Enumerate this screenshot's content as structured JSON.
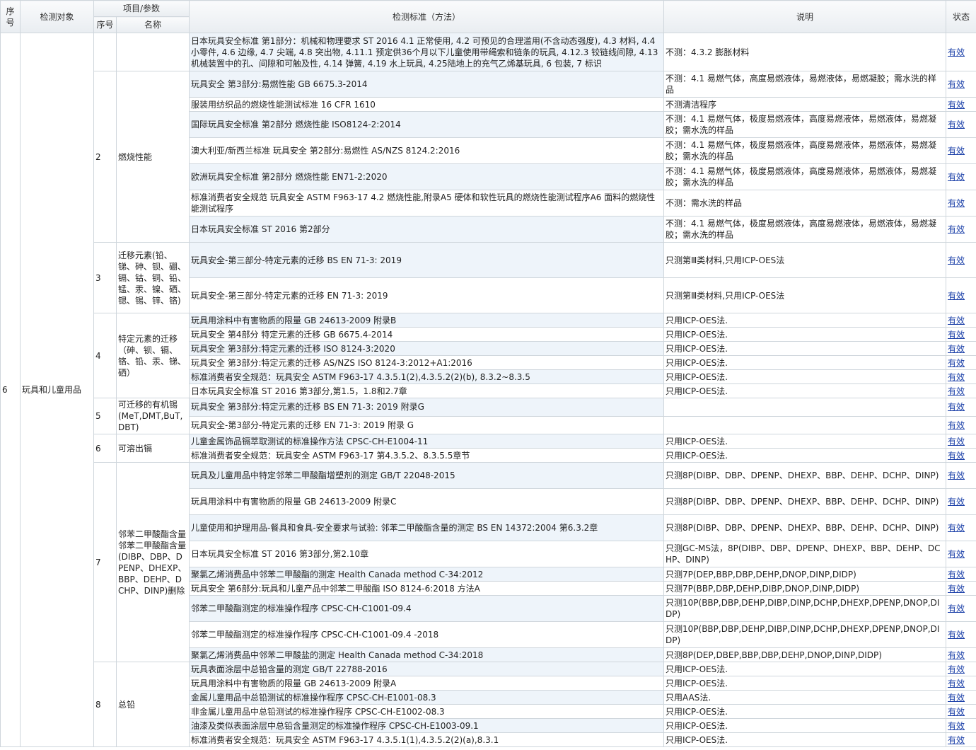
{
  "headers": {
    "seq": "序号",
    "object": "检测对象",
    "item_param": "项目/参数",
    "sub_seq": "序号",
    "sub_name": "名称",
    "standard": "检测标准（方法）",
    "note": "说明",
    "status": "状态"
  },
  "object_row": {
    "seq": "6",
    "object": "玩具和儿童用品"
  },
  "groups": [
    {
      "no": "",
      "name": "",
      "rows": [
        {
          "std": "日本玩具安全标准 第1部分：机械和物理要求 ST 2016 4.1 正常使用, 4.2 可预见的合理滥用(不含动态强度), 4.3 材料, 4.4 小零件, 4.6 边缘, 4.7 尖端, 4.8 突出物, 4.11.1 预定供36个月以下儿童使用带绳索和链条的玩具, 4.12.3 铰链线间隙, 4.13 机械装置中的孔、间隙和可触及性, 4.14 弹簧, 4.19 水上玩具, 4.25陆地上的充气乙烯基玩具, 6 包装, 7 标识",
          "note": "不测：4.3.2 膨胀材料",
          "status": "有效"
        }
      ]
    },
    {
      "no": "2",
      "name": "燃烧性能",
      "rows": [
        {
          "std": "玩具安全 第3部分:易燃性能 GB 6675.3-2014",
          "note": "不测：4.1 易燃气体，高度易燃液体，易燃液体，易燃凝胶；需水洗的样品",
          "status": "有效"
        },
        {
          "std": "服装用纺织品的燃烧性能测试标准 16 CFR 1610",
          "note": "不测清洁程序",
          "status": "有效"
        },
        {
          "std": "国际玩具安全标准 第2部分 燃烧性能 ISO8124-2:2014",
          "note": "不测：4.1 易燃气体，极度易燃液体，高度易燃液体，易燃液体，易燃凝胶；需水洗的样品",
          "status": "有效"
        },
        {
          "std": "澳大利亚/新西兰标准 玩具安全 第2部分:易燃性 AS/NZS 8124.2:2016",
          "note": "不测：4.1 易燃气体，极度易燃液体，高度易燃液体，易燃液体，易燃凝胶；需水洗的样品",
          "status": "有效"
        },
        {
          "std": "欧洲玩具安全标准 第2部分 燃烧性能 EN71-2:2020",
          "note": "不测：4.1 易燃气体，极度易燃液体，高度易燃液体，易燃液体，易燃凝胶；需水洗的样品",
          "status": "有效"
        },
        {
          "std": "标准消费者安全规范 玩具安全 ASTM F963-17 4.2 燃烧性能,附录A5 硬体和软性玩具的燃烧性能测试程序A6 面料的燃烧性能测试程序",
          "note": "不测：需水洗的样品",
          "status": "有效"
        },
        {
          "std": "日本玩具安全标准 ST 2016 第2部分",
          "note": "不测：4.1 易燃气体，极度易燃液体，高度易燃液体，易燃液体，易燃凝胶；需水洗的样品",
          "status": "有效"
        }
      ]
    },
    {
      "no": "3",
      "name": "迁移元素(铅、锑、砷、钡、硼、镉、钴、铜、铅、锰、汞、镍、硒、锶、锡、锌、铬)",
      "rows": [
        {
          "std": "玩具安全-第三部分-特定元素的迁移 BS EN 71-3: 2019",
          "note": "只测第Ⅲ类材料,只用ICP-OES法",
          "status": "有效"
        },
        {
          "std": "玩具安全-第三部分-特定元素的迁移 EN 71-3: 2019",
          "note": "只测第Ⅲ类材料,只用ICP-OES法",
          "status": "有效"
        }
      ]
    },
    {
      "no": "4",
      "name": "特定元素的迁移（砷、钡、镉、铬、铅、汞、锑、硒）",
      "rows": [
        {
          "std": "玩具用涂料中有害物质的限量 GB 24613-2009 附录B",
          "note": "只用ICP-OES法.",
          "status": "有效"
        },
        {
          "std": "玩具安全 第4部分 特定元素的迁移 GB 6675.4-2014",
          "note": "只用ICP-OES法.",
          "status": "有效"
        },
        {
          "std": "玩具安全 第3部分:特定元素的迁移 ISO 8124-3:2020",
          "note": "只用ICP-OES法.",
          "status": "有效"
        },
        {
          "std": "玩具安全 第3部分:特定元素的迁移 AS/NZS ISO 8124-3:2012+A1:2016",
          "note": "只用ICP-OES法.",
          "status": "有效"
        },
        {
          "std": "标准消费者安全规范：玩具安全 ASTM F963-17 4.3.5.1(2),4.3.5.2(2)(b), 8.3.2~8.3.5",
          "note": "只用ICP-OES法.",
          "status": "有效"
        },
        {
          "std": "日本玩具安全标准 ST 2016 第3部分,第1.5，1.8和2.7章",
          "note": "只用ICP-OES法.",
          "status": "有效"
        }
      ]
    },
    {
      "no": "5",
      "name": "可迁移的有机锡(MeT,DMT,BuT,DBT)",
      "rows": [
        {
          "std": "玩具安全 第3部分:特定元素的迁移 BS EN 71-3: 2019 附录G",
          "note": "",
          "status": "有效"
        },
        {
          "std": "玩具安全-第3部分-特定元素的迁移 EN 71-3: 2019 附录 G",
          "note": "",
          "status": "有效"
        }
      ]
    },
    {
      "no": "6",
      "name": "可溶出镉",
      "rows": [
        {
          "std": "儿童金属饰品镉萃取测试的标准操作方法 CPSC-CH-E1004-11",
          "note": "只用ICP-OES法.",
          "status": "有效"
        },
        {
          "std": "标准消费者安全规范：玩具安全 ASTM F963-17 第4.3.5.2、8.3.5.5章节",
          "note": "只用ICP-OES法.",
          "status": "有效"
        }
      ]
    },
    {
      "no": "7",
      "name": "邻苯二甲酸酯含量邻苯二甲酸酯含量(DIBP、DBP、DPENP、DHEXP、BBP、DEHP、DCHP、DINP)删除",
      "rows": [
        {
          "std": "玩具及儿童用品中特定邻苯二甲酸酯增塑剂的测定 GB/T 22048-2015",
          "note": "只测8P(DIBP、DBP、DPENP、DHEXP、BBP、DEHP、DCHP、DINP)",
          "status": "有效"
        },
        {
          "std": "玩具用涂料中有害物质的限量 GB 24613-2009 附录C",
          "note": "只测8P(DIBP、DBP、DPENP、DHEXP、BBP、DEHP、DCHP、DINP)",
          "status": "有效"
        },
        {
          "std": "儿童使用和护理用品-餐具和食具-安全要求与试验: 邻苯二甲酸酯含量的测定 BS EN 14372:2004 第6.3.2章",
          "note": "只测8P(DIBP、DBP、DPENP、DHEXP、BBP、DEHP、DCHP、DINP)",
          "status": "有效"
        },
        {
          "std": "日本玩具安全标准 ST 2016 第3部分,第2.10章",
          "note": "只测GC-MS法，8P(DIBP、DBP、DPENP、DHEXP、BBP、DEHP、DCHP、DINP)",
          "status": "有效"
        },
        {
          "std": "聚氯乙烯消费品中邻苯二甲酸酯的测定 Health Canada method C-34:2012",
          "note": "只测7P(DEP,BBP,DBP,DEHP,DNOP,DINP,DIDP)",
          "status": "有效"
        },
        {
          "std": "玩具安全 第6部分:玩具和儿童产品中邻苯二甲酸酯 ISO 8124-6:2018 方法A",
          "note": "只测7P(BBP,DBP,DEHP,DIBP,DNOP,DINP,DIDP)",
          "status": "有效"
        },
        {
          "std": "邻苯二甲酸酯测定的标准操作程序 CPSC-CH-C1001-09.4",
          "note": "只测10P(BBP,DBP,DEHP,DIBP,DINP,DCHP,DHEXP,DPENP,DNOP,DIDP)",
          "status": "有效"
        },
        {
          "std": "邻苯二甲酸酯测定的标准操作程序 CPSC-CH-C1001-09.4 -2018",
          "note": "只测10P(BBP,DBP,DEHP,DIBP,DINP,DCHP,DHEXP,DPENP,DNOP,DIDP)",
          "status": "有效"
        },
        {
          "std": "聚氯乙烯消费品中邻苯二甲酸盐的测定 Health Canada method C-34:2018",
          "note": "只测8P(DEP,DBEP,BBP,DBP,DEHP,DNOP,DINP,DIDP)",
          "status": "有效"
        }
      ]
    },
    {
      "no": "8",
      "name": "总铅",
      "rows": [
        {
          "std": "玩具表面涂层中总铅含量的测定 GB/T 22788-2016",
          "note": "只用ICP-OES法.",
          "status": "有效"
        },
        {
          "std": "玩具用涂料中有害物质的限量 GB 24613-2009 附录A",
          "note": "只用ICP-OES法.",
          "status": "有效"
        },
        {
          "std": "金属儿童用品中总铅测试的标准操作程序 CPSC-CH-E1001-08.3",
          "note": "只用AAS法.",
          "status": "有效"
        },
        {
          "std": "非金属儿童用品中总铅测试的标准操作程序 CPSC-CH-E1002-08.3",
          "note": "只用ICP-OES法.",
          "status": "有效"
        },
        {
          "std": "油漆及类似表面涂层中总铅含量测定的标准操作程序 CPSC-CH-E1003-09.1",
          "note": "只用ICP-OES法.",
          "status": "有效"
        },
        {
          "std": "标准消费者安全规范：玩具安全 ASTM F963-17 4.3.5.1(1),4.3.5.2(2)(a),8.3.1",
          "note": "只用ICP-OES法.",
          "status": "有效"
        }
      ]
    }
  ]
}
